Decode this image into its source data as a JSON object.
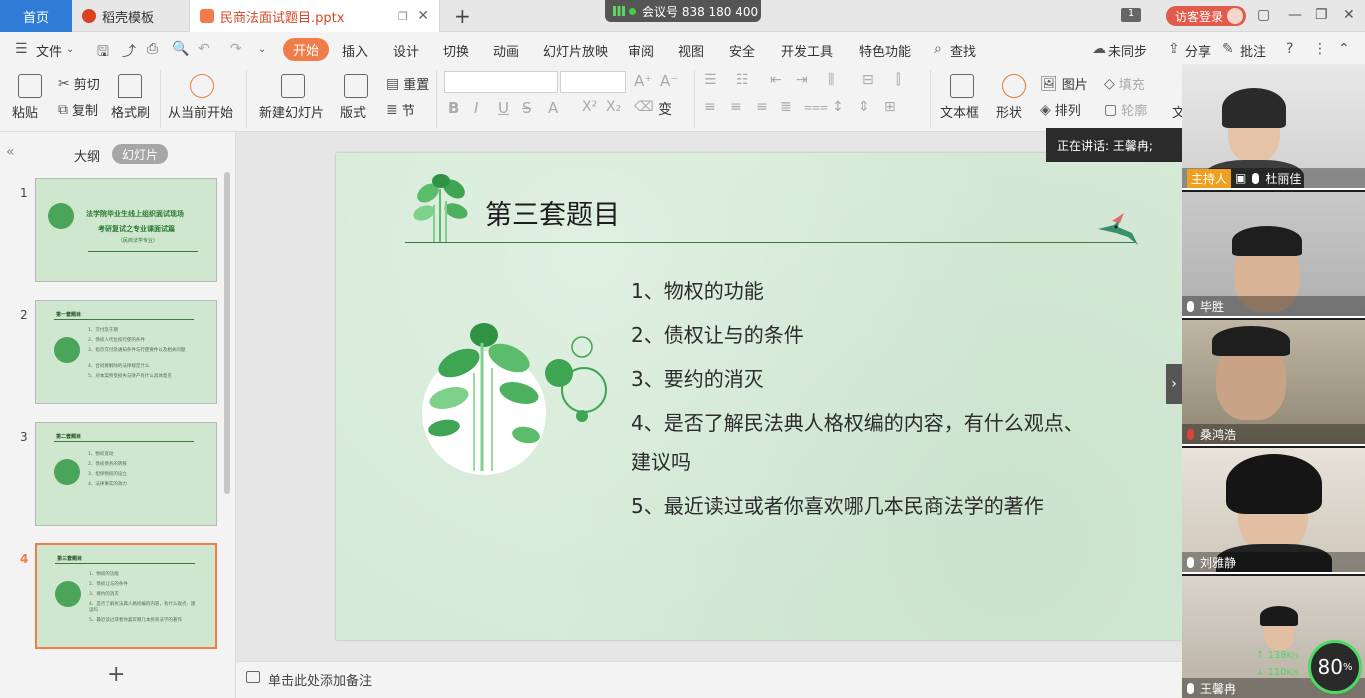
{
  "tabbar": {
    "home": "首页",
    "template_tab": "稻壳模板",
    "doc_tab": "民商法面试题目.pptx",
    "meeting": "会议号 838 180 400",
    "page_badge": "1",
    "login": "访客登录"
  },
  "menubar": {
    "file": "文件",
    "items": [
      "开始",
      "插入",
      "设计",
      "切换",
      "动画",
      "幻灯片放映",
      "审阅",
      "视图",
      "安全",
      "开发工具",
      "特色功能"
    ],
    "search": "查找",
    "sync": "未同步",
    "share": "分享",
    "comment": "批注"
  },
  "ribbon": {
    "paste": "粘贴",
    "cut": "剪切",
    "copy": "复制",
    "format_painter": "格式刷",
    "from_current": "从当前开始",
    "new_slide": "新建幻灯片",
    "layout": "版式",
    "reset": "重置",
    "section": "节",
    "textbox": "文本框",
    "shape": "形状",
    "picture": "图片",
    "fill": "填充",
    "arrange": "排列",
    "outline": "轮廓",
    "text_partial": "文"
  },
  "leftpanel": {
    "outline_tab": "大纲",
    "slides_tab": "幻灯片",
    "thumbs": [
      {
        "num": "1",
        "title": "法学院毕业生线上组织面试现场",
        "sub": "考研复试之专业课面试篇",
        "note": "（民商法学专业）"
      },
      {
        "num": "2",
        "title": "第一套题目",
        "lines": [
          "1、交付及于期",
          "2、债权人代位权行使的条件",
          "3、指示交付及通知条件与行使要件以及相关问题",
          "4、合同要解除的法律规定什么",
          "5、对本案所受损失与财产有什么具体意见"
        ]
      },
      {
        "num": "3",
        "title": "第二套题目",
        "lines": [
          "1、物权变动",
          "2、债权债务的转移",
          "3、担保物权的设立",
          "4、法律事实的效力"
        ]
      },
      {
        "num": "4",
        "title": "第三套题目",
        "lines": [
          "1、物权的功能",
          "2、债权让与的条件",
          "3、要约的消灭",
          "4、是否了解民法典人格权编的内容，有什么观点、建议吗",
          "5、最近读过或者你喜欢哪几本民商法学的著作"
        ]
      }
    ],
    "selected": "4"
  },
  "slide": {
    "title": "第三套题目",
    "items": [
      "1、物权的功能",
      "2、债权让与的条件",
      "3、要约的消灭",
      "4、是否了解民法典人格权编的内容，有什么观点、",
      "建议吗",
      "5、最近读过或者你喜欢哪几本民商法学的著作"
    ]
  },
  "notes": {
    "placeholder": "单击此处添加备注"
  },
  "speaking": "正在讲话: 王馨冉;",
  "participants": [
    {
      "name": "杜丽佳",
      "role": "主持人",
      "mic": "on"
    },
    {
      "name": "毕胜",
      "mic": "on"
    },
    {
      "name": "桑鸿浩",
      "mic": "off"
    },
    {
      "name": "刘雅静",
      "mic": "on"
    },
    {
      "name": "王馨冉",
      "mic": "on"
    }
  ],
  "network": {
    "up": "138",
    "down": "110",
    "unit": "K/s",
    "quality": "80"
  }
}
